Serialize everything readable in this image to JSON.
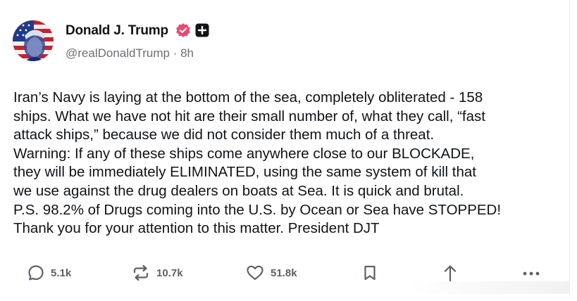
{
  "author": {
    "display_name": "Donald J. Trump",
    "handle": "@realDonaldTrump",
    "separator": " · ",
    "time_ago": "8h",
    "verified_icon": "verified-badge-icon",
    "extra_icon": "plus-square-icon",
    "verified_color": "#f0466e"
  },
  "post": {
    "text": "Iran’s Navy is laying at the bottom of the sea, completely obliterated - 158\nships. What we have not hit are their small number of, what they call, “fast\nattack ships,” because we did not consider them much of a threat.\nWarning: If any of these ships come anywhere close to our BLOCKADE,\nthey will be immediately ELIMINATED, using the same system of kill that\nwe use against the drug dealers on boats at Sea. It is quick and brutal.\nP.S. 98.2% of Drugs coming into the U.S. by Ocean or Sea have STOPPED!\nThank you for your attention to this matter. President DJT"
  },
  "actions": {
    "replies": "5.1k",
    "reposts": "10.7k",
    "likes": "51.8k",
    "icons": [
      "reply-icon",
      "repost-icon",
      "like-icon",
      "bookmark-icon",
      "share-icon",
      "more-icon"
    ]
  },
  "colors": {
    "text": "#0f1419",
    "muted": "#6b6f76",
    "action": "#5b6168"
  }
}
